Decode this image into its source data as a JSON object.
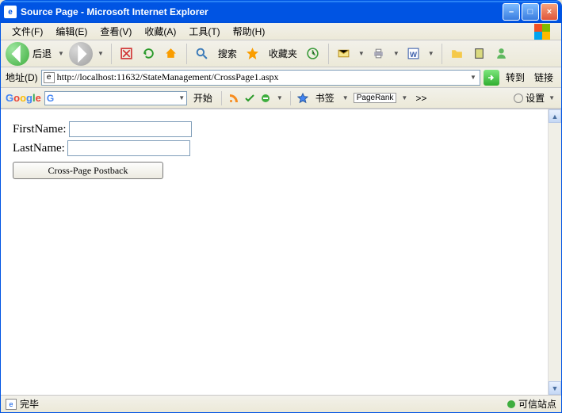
{
  "window": {
    "title": "Source Page - Microsoft Internet Explorer"
  },
  "menu": {
    "file": "文件(F)",
    "edit": "编辑(E)",
    "view": "查看(V)",
    "favorites": "收藏(A)",
    "tools": "工具(T)",
    "help": "帮助(H)"
  },
  "toolbar": {
    "back": "后退",
    "search": "搜索",
    "favorites": "收藏夹"
  },
  "addressbar": {
    "label": "地址(D)",
    "url": "http://localhost:11632/StateManagement/CrossPage1.aspx",
    "go": "转到",
    "links": "链接"
  },
  "googlebar": {
    "logo": "Google",
    "search_value": "G",
    "start": "开始",
    "bookmarks": "书签",
    "pagerank": "PageRank",
    "more": ">>",
    "settings": "设置"
  },
  "form": {
    "first_name_label": "FirstName:",
    "first_name_value": "",
    "last_name_label": "LastName:",
    "last_name_value": "",
    "submit": "Cross-Page Postback"
  },
  "statusbar": {
    "done": "完毕",
    "trusted": "可信站点"
  }
}
